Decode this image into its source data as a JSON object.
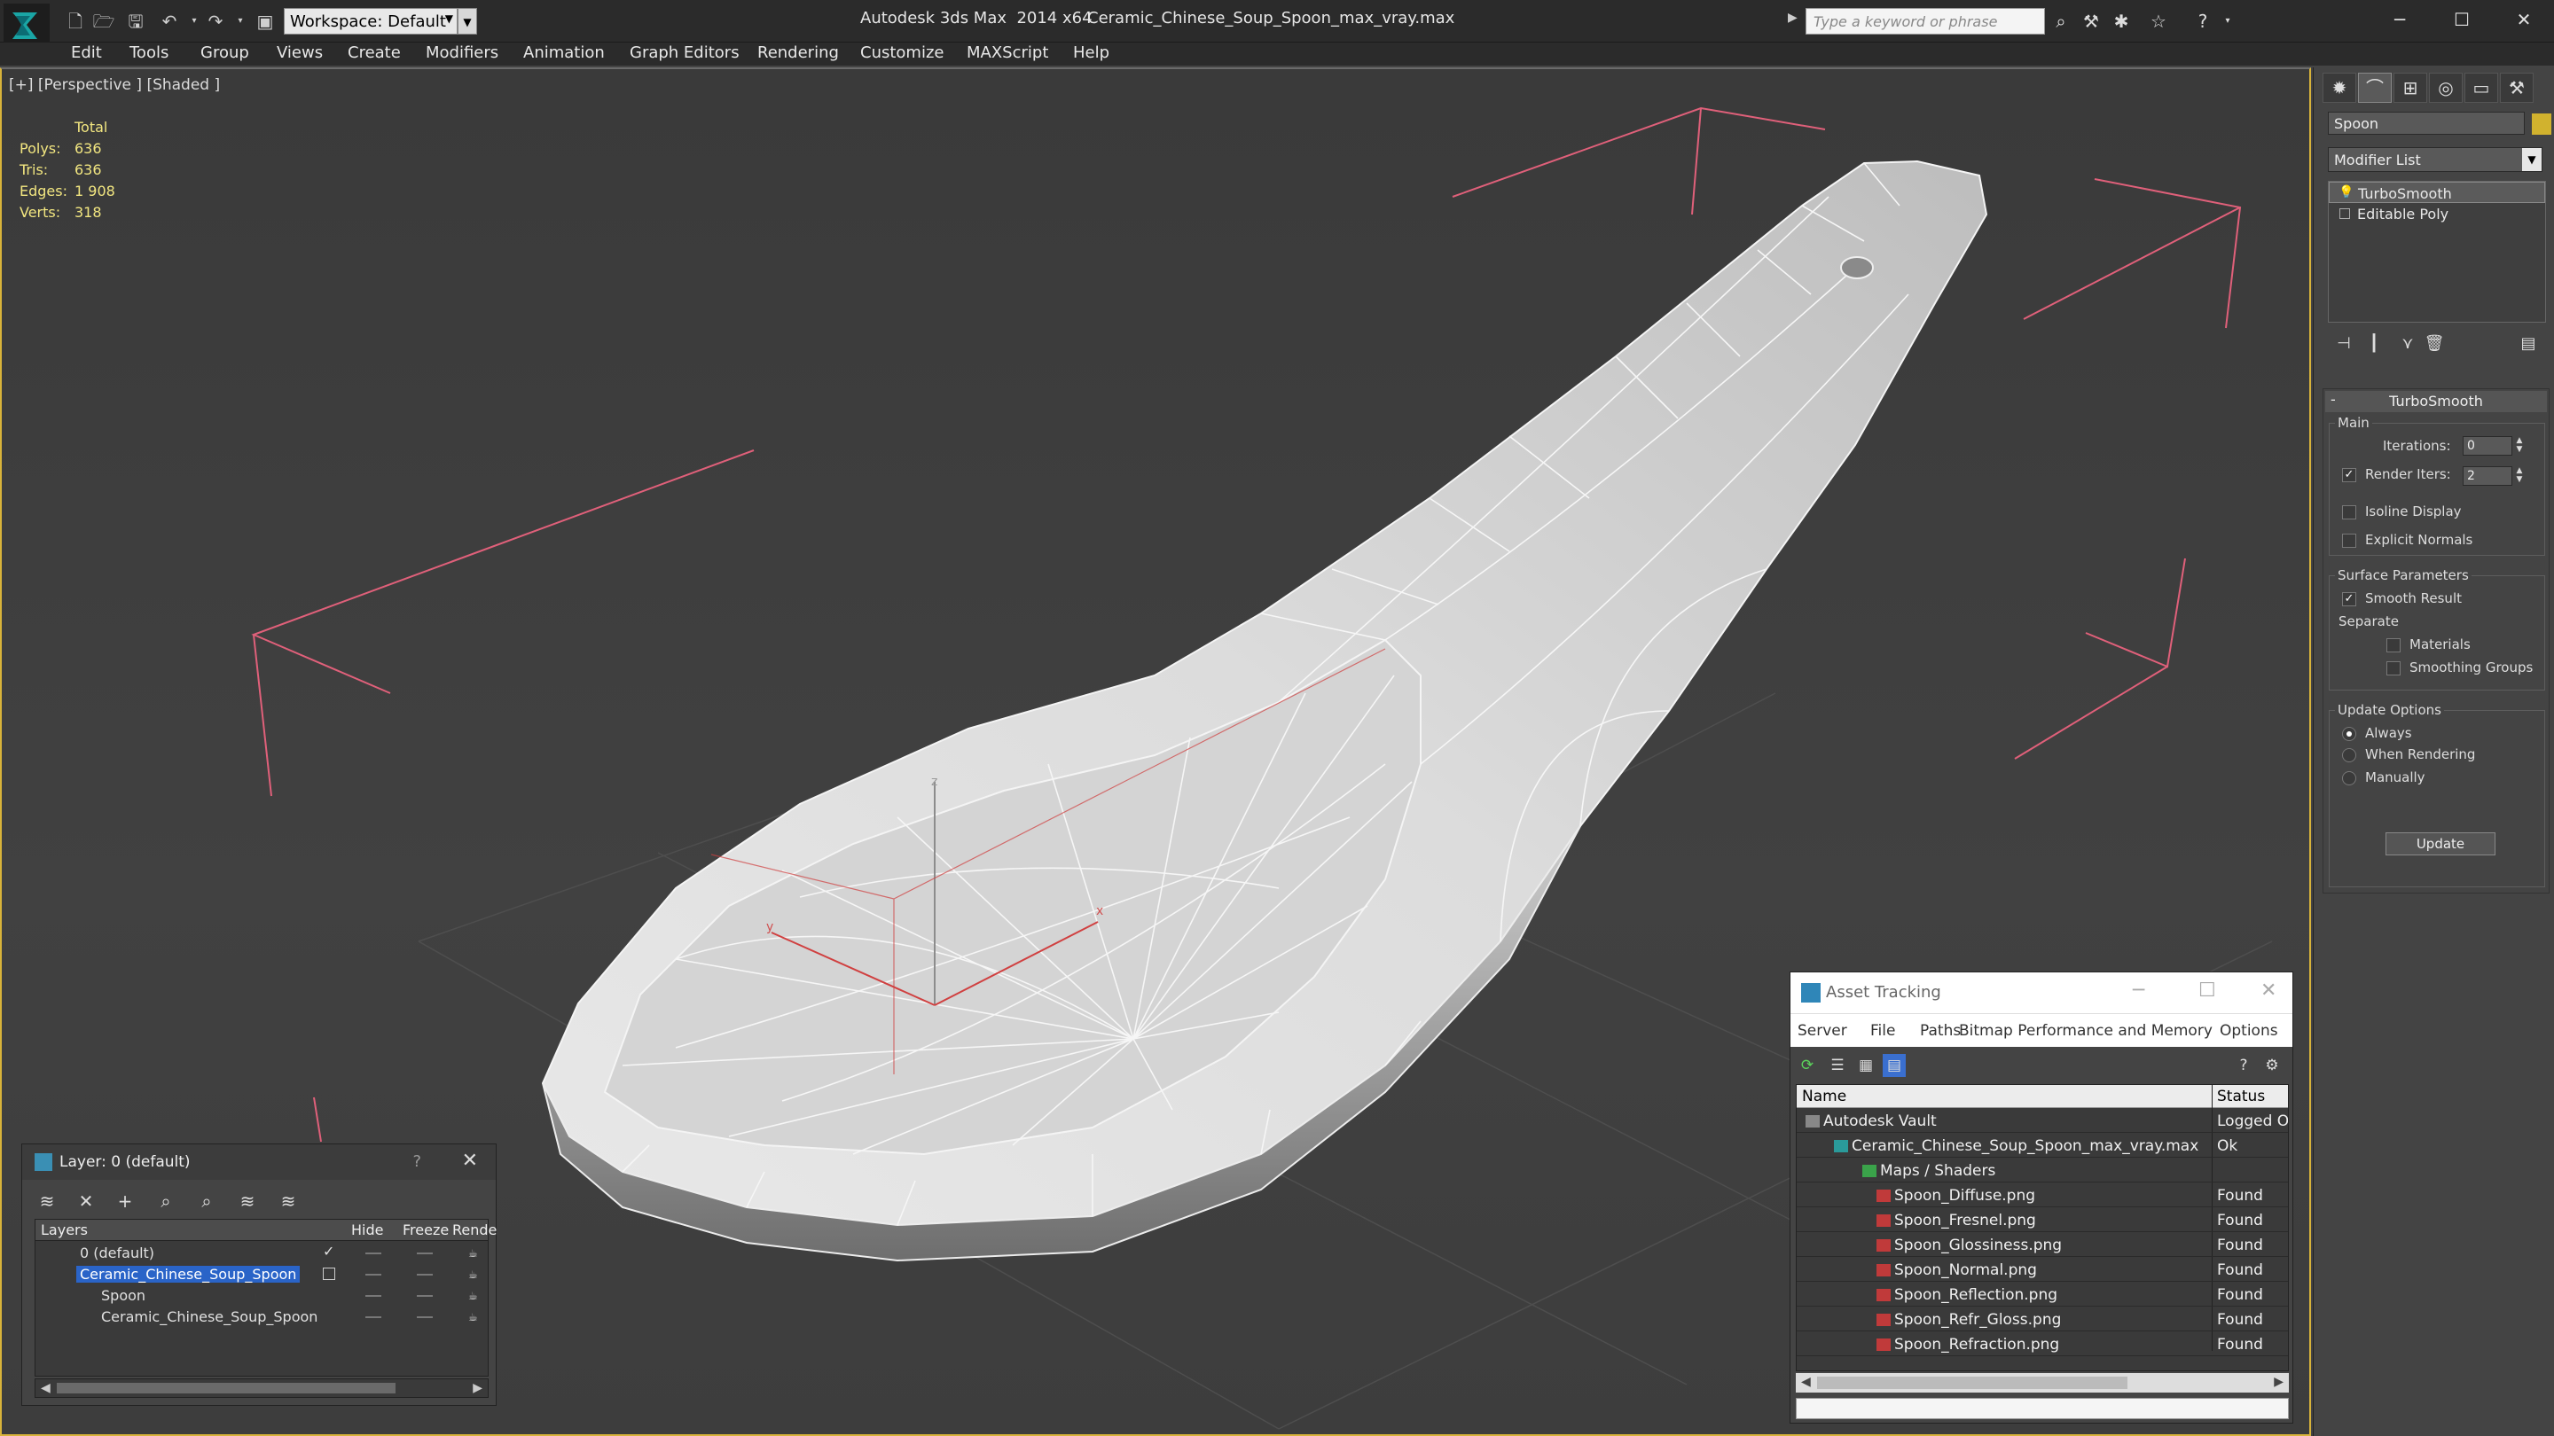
{
  "titlebar": {
    "app_title": "Autodesk 3ds Max  2014 x64",
    "file_name": "Ceramic_Chinese_Soup_Spoon_max_vray.max",
    "workspace": "Workspace: Default",
    "search_placeholder": "Type a keyword or phrase"
  },
  "menu": [
    "Edit",
    "Tools",
    "Group",
    "Views",
    "Create",
    "Modifiers",
    "Animation",
    "Graph Editors",
    "Rendering",
    "Customize",
    "MAXScript",
    "Help"
  ],
  "viewport": {
    "label": "[+] [Perspective ] [Shaded ]",
    "stats": {
      "total_label": "Total",
      "rows": [
        {
          "k": "Polys:",
          "v": "636"
        },
        {
          "k": "Tris:",
          "v": "636"
        },
        {
          "k": "Edges:",
          "v": "1 908"
        },
        {
          "k": "Verts:",
          "v": "318"
        }
      ]
    },
    "gizmo": {
      "x": "x",
      "y": "y",
      "z": "z"
    }
  },
  "command_panel": {
    "object_name": "Spoon",
    "object_color": "#d1b22e",
    "modifier_list": "Modifier List",
    "stack": [
      "TurboSmooth",
      "Editable Poly"
    ],
    "rollout_title": "TurboSmooth",
    "main_group": "Main",
    "iterations_label": "Iterations:",
    "iterations_value": "0",
    "render_iters_label": "Render Iters:",
    "render_iters_value": "2",
    "isoline_label": "Isoline Display",
    "explicit_normals_label": "Explicit Normals",
    "surface_group": "Surface Parameters",
    "smooth_result_label": "Smooth Result",
    "separate_label": "Separate",
    "materials_label": "Materials",
    "smoothing_groups_label": "Smoothing Groups",
    "update_group": "Update Options",
    "always_label": "Always",
    "when_rendering_label": "When Rendering",
    "manually_label": "Manually",
    "update_button": "Update"
  },
  "layer_dialog": {
    "title": "Layer: 0 (default)",
    "help": "?",
    "columns": {
      "layers": "Layers",
      "hide": "Hide",
      "freeze": "Freeze",
      "render": "Rende"
    },
    "rows": [
      {
        "name": "0 (default)"
      },
      {
        "name": "Ceramic_Chinese_Soup_Spoon"
      },
      {
        "name": "Spoon"
      },
      {
        "name": "Ceramic_Chinese_Soup_Spoon"
      }
    ]
  },
  "asset_dialog": {
    "title": "Asset Tracking",
    "menu": [
      "Server",
      "File",
      "Paths",
      "Bitmap Performance and Memory",
      "Options"
    ],
    "columns": {
      "name": "Name",
      "status": "Status"
    },
    "rows": [
      {
        "name": "Autodesk Vault",
        "status": "Logged O"
      },
      {
        "name": "Ceramic_Chinese_Soup_Spoon_max_vray.max",
        "status": "Ok"
      },
      {
        "name": "Maps / Shaders",
        "status": ""
      },
      {
        "name": "Spoon_Diffuse.png",
        "status": "Found"
      },
      {
        "name": "Spoon_Fresnel.png",
        "status": "Found"
      },
      {
        "name": "Spoon_Glossiness.png",
        "status": "Found"
      },
      {
        "name": "Spoon_Normal.png",
        "status": "Found"
      },
      {
        "name": "Spoon_Reflection.png",
        "status": "Found"
      },
      {
        "name": "Spoon_Refr_Gloss.png",
        "status": "Found"
      },
      {
        "name": "Spoon_Refraction.png",
        "status": "Found"
      }
    ]
  }
}
